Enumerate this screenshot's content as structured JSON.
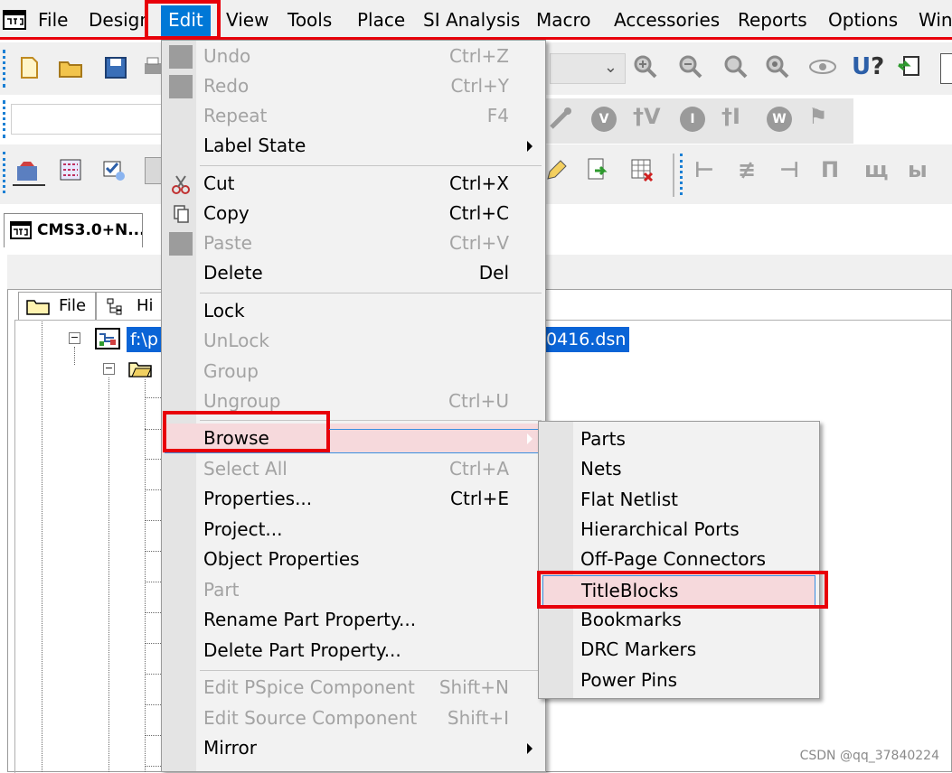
{
  "menubar": {
    "items": [
      "File",
      "Design",
      "Edit",
      "View",
      "Tools",
      "Place",
      "SI Analysis",
      "Macro",
      "Accessories",
      "Reports",
      "Options",
      "Window"
    ],
    "active": "Edit"
  },
  "toolbar": {
    "icons": [
      "new-icon",
      "open-icon",
      "save-icon",
      "print-icon",
      "zoom-in-icon",
      "zoom-out-icon",
      "zoom-area-icon",
      "zoom-all-icon",
      "view-icon",
      "help-icon",
      "back-annotate-icon"
    ],
    "row2_round_icons": [
      "V",
      "I",
      "W"
    ],
    "row3_icons": [
      "project-manager-icon",
      "netlist-icon",
      "drc-icon",
      "edit-icon",
      "forward-icon",
      "delete-table-icon",
      "align-left-icon",
      "align-center-icon",
      "align-right-icon",
      "align-top-icon",
      "align-middle-icon",
      "align-bottom-icon"
    ]
  },
  "document_tab": {
    "label": "CMS3.0+N..."
  },
  "tree": {
    "tabs": [
      "File",
      "Hi"
    ],
    "selected_path_prefix": "f:\\p",
    "selected_path_suffix": "0416.dsn"
  },
  "edit_menu": {
    "items": [
      {
        "label": "Undo",
        "shortcut": "Ctrl+Z",
        "disabled": true,
        "icon": "gray-square-icon"
      },
      {
        "label": "Redo",
        "shortcut": "Ctrl+Y",
        "disabled": true,
        "icon": "gray-square-icon"
      },
      {
        "label": "Repeat",
        "shortcut": "F4",
        "disabled": true
      },
      {
        "label": "Label State",
        "shortcut": "",
        "disabled": false,
        "submenu": true
      },
      {
        "label": "Cut",
        "shortcut": "Ctrl+X",
        "disabled": false,
        "icon": "scissors-icon"
      },
      {
        "label": "Copy",
        "shortcut": "Ctrl+C",
        "disabled": false,
        "icon": "copy-icon"
      },
      {
        "label": "Paste",
        "shortcut": "Ctrl+V",
        "disabled": true,
        "icon": "gray-square-icon"
      },
      {
        "label": "Delete",
        "shortcut": "Del",
        "disabled": false
      },
      {
        "label": "Lock",
        "shortcut": "",
        "disabled": false
      },
      {
        "label": "UnLock",
        "shortcut": "",
        "disabled": true
      },
      {
        "label": "Group",
        "shortcut": "",
        "disabled": true
      },
      {
        "label": "Ungroup",
        "shortcut": "Ctrl+U",
        "disabled": true
      },
      {
        "label": "Browse",
        "shortcut": "",
        "disabled": false,
        "submenu": true,
        "highlighted": true
      },
      {
        "label": "Select All",
        "shortcut": "Ctrl+A",
        "disabled": true
      },
      {
        "label": "Properties...",
        "shortcut": "Ctrl+E",
        "disabled": false
      },
      {
        "label": "Project...",
        "shortcut": "",
        "disabled": false
      },
      {
        "label": "Object Properties",
        "shortcut": "",
        "disabled": false
      },
      {
        "label": "Part",
        "shortcut": "",
        "disabled": true
      },
      {
        "label": "Rename Part Property...",
        "shortcut": "",
        "disabled": false
      },
      {
        "label": "Delete Part Property...",
        "shortcut": "",
        "disabled": false
      },
      {
        "label": "Edit PSpice Component",
        "shortcut": "Shift+N",
        "disabled": true
      },
      {
        "label": "Edit Source Component",
        "shortcut": "Shift+I",
        "disabled": true
      },
      {
        "label": "Mirror",
        "shortcut": "",
        "disabled": false,
        "submenu": true
      }
    ]
  },
  "browse_submenu": {
    "items": [
      {
        "label": "Parts"
      },
      {
        "label": "Nets"
      },
      {
        "label": "Flat Netlist"
      },
      {
        "label": "Hierarchical Ports"
      },
      {
        "label": "Off-Page Connectors"
      },
      {
        "label": "TitleBlocks",
        "highlighted": true
      },
      {
        "label": "Bookmarks"
      },
      {
        "label": "DRC Markers"
      },
      {
        "label": "Power Pins"
      }
    ]
  },
  "watermark": "CSDN @qq_37840224",
  "colors": {
    "menu_active_bg": "#0078d7",
    "annotation_red": "#e8000a",
    "highlight_bg": "#f6d9dc",
    "selection_blue": "#0a64d6",
    "disabled_text": "#a3a3a3"
  }
}
